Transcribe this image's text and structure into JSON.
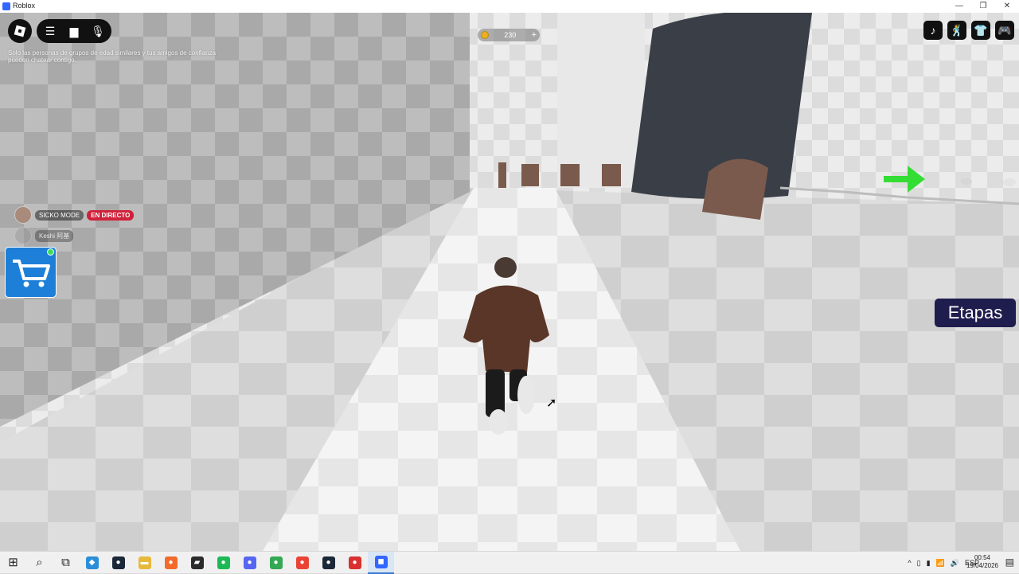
{
  "window": {
    "title": "Roblox",
    "controls": [
      "—",
      "❐",
      "✕"
    ]
  },
  "hud": {
    "chat_notice": "Solo las personas de grupos de edad similares y tus amigos de confianza pueden chatear contigo.",
    "coins": "230",
    "coin_plus": "+",
    "top_right_icons": [
      "music-icon",
      "emote-icon",
      "shirt-icon",
      "gamepad-icon"
    ],
    "top_right_glyphs": [
      "♪",
      "🕺",
      "👕",
      "🎮"
    ],
    "live_user": "SICKO MODE",
    "live_badge": "EN DIRECTO",
    "second_user": "Keshi 阿基",
    "stages_button": "Etapas"
  },
  "taskbar": {
    "apps": [
      {
        "name": "start-icon",
        "glyph": "⊞",
        "color": "#1e1e1e"
      },
      {
        "name": "search-icon",
        "glyph": "⌕",
        "color": "#1e1e1e"
      },
      {
        "name": "task-view-icon",
        "glyph": "⧉",
        "color": "#1e1e1e"
      },
      {
        "name": "vscode-icon",
        "glyph": "◆",
        "color": "#2a8ed8"
      },
      {
        "name": "steam-icon",
        "glyph": "●",
        "color": "#1b2838"
      },
      {
        "name": "folder-icon",
        "glyph": "▬",
        "color": "#e7b93a"
      },
      {
        "name": "app-orange-icon",
        "glyph": "●",
        "color": "#f26b2b"
      },
      {
        "name": "notes-icon",
        "glyph": "▰",
        "color": "#2b2b2b"
      },
      {
        "name": "spotify-icon",
        "glyph": "●",
        "color": "#1db954"
      },
      {
        "name": "discord-icon",
        "glyph": "●",
        "color": "#5865f2"
      },
      {
        "name": "chrome-icon",
        "glyph": "●",
        "color": "#34a853"
      },
      {
        "name": "chrome-profile-icon",
        "glyph": "●",
        "color": "#ea4335"
      },
      {
        "name": "steam-2-icon",
        "glyph": "●",
        "color": "#1b2838"
      },
      {
        "name": "app-red-icon",
        "glyph": "●",
        "color": "#d93030"
      },
      {
        "name": "roblox-icon",
        "glyph": "◼",
        "color": "#3366ff"
      }
    ],
    "tray_glyphs": [
      "^",
      "▯",
      "▮",
      "📶",
      "🔊"
    ],
    "language": "ESP",
    "time": "00:54",
    "date": "19/04/2026",
    "notification_glyph": "▤"
  },
  "colors": {
    "stages_bg": "#1f1d4e",
    "live_badge": "#d0213a",
    "shop_bg": "#1e7fd8",
    "arrow": "#33dd33"
  }
}
